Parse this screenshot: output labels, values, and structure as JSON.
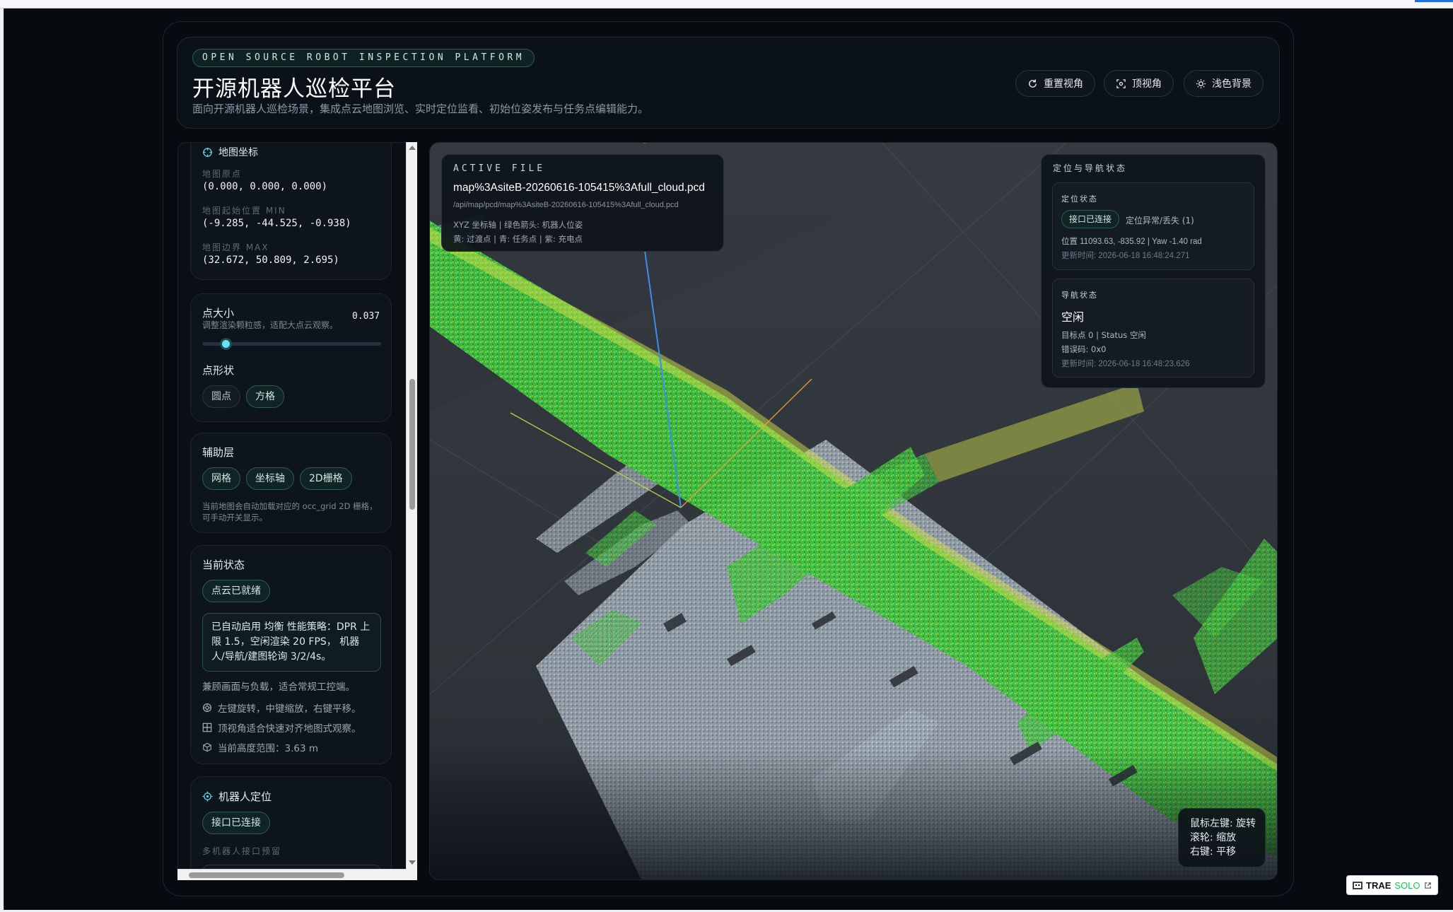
{
  "header": {
    "eyebrow": "OPEN SOURCE ROBOT INSPECTION PLATFORM",
    "title": "开源机器人巡检平台",
    "subtitle": "面向开源机器人巡检场景，集成点云地图浏览、实时定位监看、初始位姿发布与任务点编辑能力。",
    "buttons": {
      "reset": "重置视角",
      "top": "顶视角",
      "light": "浅色背景"
    }
  },
  "coords": {
    "title": "地图坐标",
    "origin_label": "地图原点",
    "origin_value": "(0.000, 0.000, 0.000)",
    "min_label": "地图起始位置 MIN",
    "min_value": "(-9.285, -44.525, -0.938)",
    "max_label": "地图边界 MAX",
    "max_value": "(32.672, 50.809, 2.695)"
  },
  "point": {
    "size_label": "点大小",
    "size_hint": "调整渲染颗粒感，适配大点云观察。",
    "size_value": "0.037",
    "size_fraction": 0.13,
    "shape_label": "点形状",
    "shape_round": "圆点",
    "shape_square": "方格"
  },
  "aux": {
    "title": "辅助层",
    "grid": "网格",
    "axes": "坐标轴",
    "grid2d": "2D栅格",
    "note": "当前地图会自动加载对应的 occ_grid 2D 栅格，可手动开关显示。"
  },
  "status": {
    "title": "当前状态",
    "chip": "点云已就绪",
    "box": "已自动启用 均衡 性能策略：DPR 上限 1.5，空闲渲染 20 FPS， 机器人/导航/建图轮询 3/2/4s。",
    "line1": "兼顾画面与负载，适合常规工控端。",
    "tip1": "左键旋转，中键缩放，右键平移。",
    "tip2": "顶视角适合快速对齐地图式观察。",
    "tip3": "当前高度范围：3.63 m"
  },
  "robot": {
    "title": "机器人定位",
    "chip": "接口已连接",
    "note": "多机器人接口预留"
  },
  "file": {
    "eyebrow": "ACTIVE FILE",
    "name": "map%3AsiteB-20260616-105415%3Afull_cloud.pcd",
    "path": "/api/map/pcd/map%3AsiteB-20260616-105415%3Afull_cloud.pcd",
    "legend1": "XYZ 坐标轴 | 绿色箭头: 机器人位姿",
    "legend2": "黄: 过渡点 | 青: 任务点 | 紫: 充电点"
  },
  "nav": {
    "title": "定位与导航状态",
    "loc_title": "定位状态",
    "loc_chip": "接口已连接",
    "loc_state": "定位异常/丢失 (1)",
    "loc_pos": "位置 11093.63, -835.92 | Yaw -1.40 rad",
    "loc_time": "更新时间:  2026-06-18 16:48:24.271",
    "nav_title": "导航状态",
    "nav_state": "空闲",
    "nav_target": "目标点 0 | Status 空闲",
    "nav_err": "错误码:  0x0",
    "nav_time": "更新时间:  2026-06-18 16:48:23.626"
  },
  "mouse": {
    "left": "鼠标左键: 旋转",
    "wheel": "滚轮: 缩放",
    "right": "右键: 平移"
  },
  "brand": {
    "name": "TRAE",
    "solo": "SOLO"
  },
  "colors": {
    "accent": "#5fd3e0",
    "bg": "#070b10",
    "cloud_green": "#3fd24a"
  }
}
